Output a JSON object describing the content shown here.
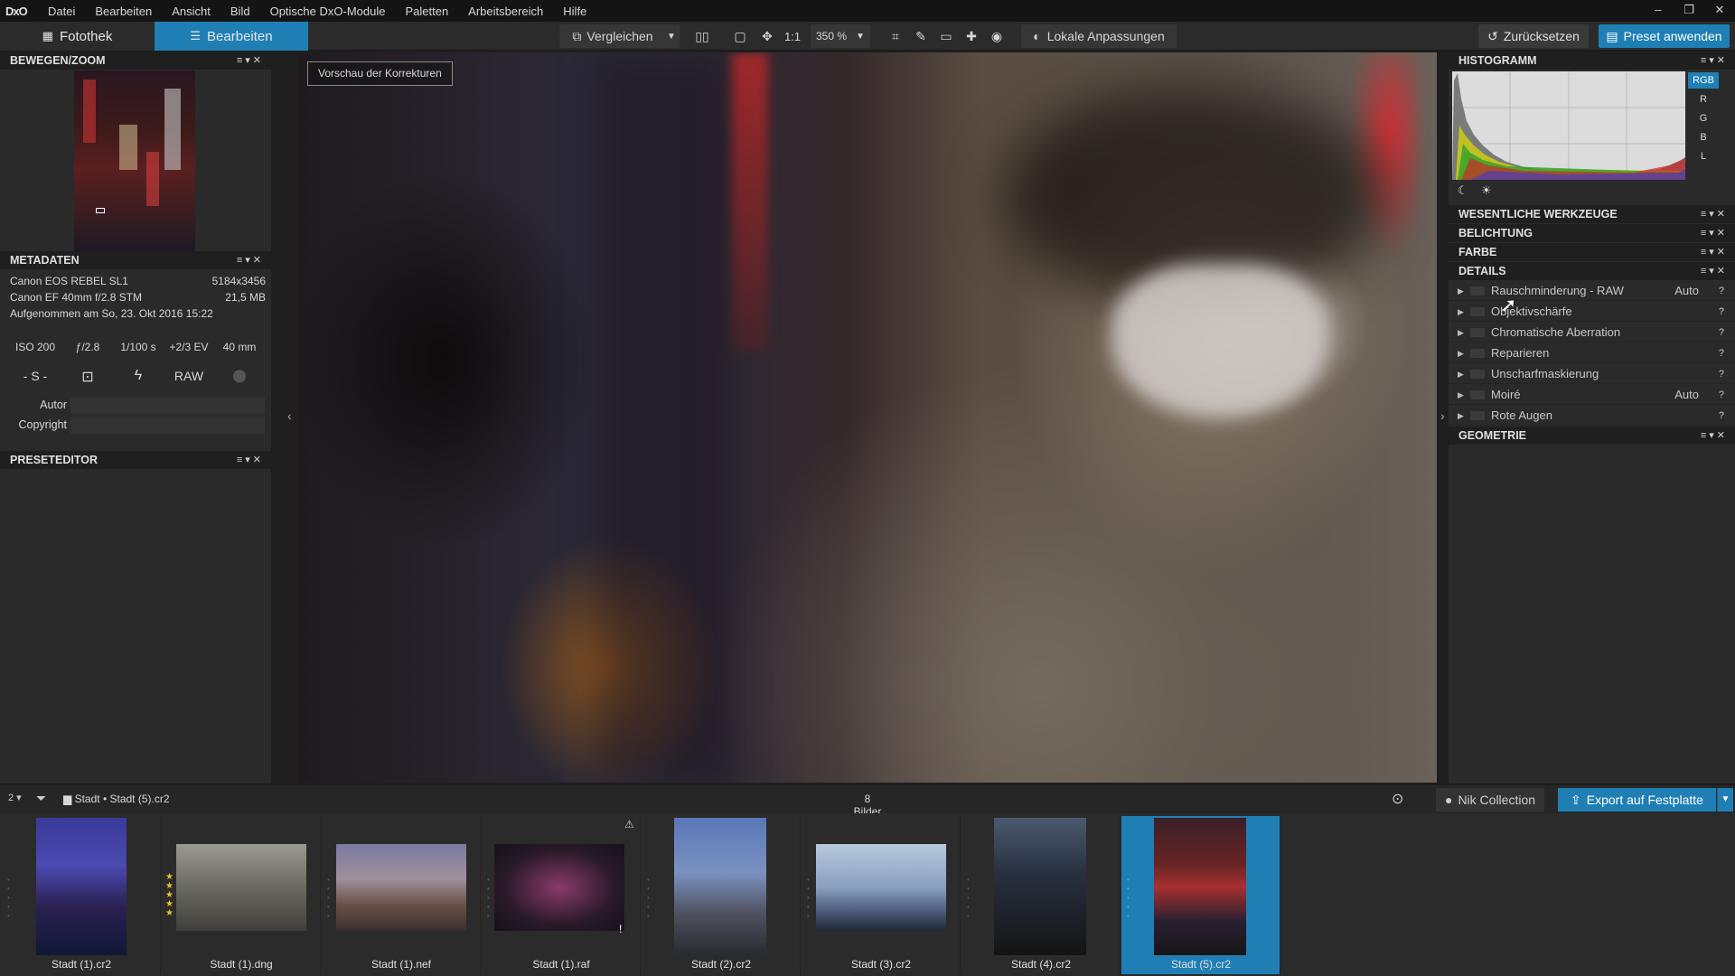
{
  "app": {
    "logo": "DxO"
  },
  "menu": [
    "Datei",
    "Bearbeiten",
    "Ansicht",
    "Bild",
    "Optische DxO-Module",
    "Paletten",
    "Arbeitsbereich",
    "Hilfe"
  ],
  "window_controls": [
    "–",
    "❐",
    "✕"
  ],
  "tabs": {
    "fotothek": "Fotothek",
    "bearbeiten": "Bearbeiten"
  },
  "toolbar": {
    "vergleichen": "Vergleichen",
    "one_to_one": "1:1",
    "zoom": "350 %",
    "lokale": "Lokale Anpassungen",
    "zuruck": "Zurücksetzen",
    "preset": "Preset anwenden"
  },
  "left": {
    "bewegen_title": "BEWEGEN/ZOOM",
    "metadaten_title": "METADATEN",
    "preseteditor_title": "PRESETEDITOR",
    "camera": "Canon EOS REBEL SL1",
    "resolution": "5184x3456",
    "lens": "Canon EF 40mm f/2.8 STM",
    "filesize": "21,5 MB",
    "taken": "Aufgenommen am So, 23. Okt 2016 15:22",
    "exif": [
      "ISO 200",
      "ƒ/2.8",
      "1/100 s",
      "+2/3 EV",
      "40 mm"
    ],
    "mode": "- S -",
    "raw": "RAW",
    "autor_label": "Autor",
    "copyright_label": "Copyright"
  },
  "viewer": {
    "preview_label": "Vorschau der Korrekturen"
  },
  "right": {
    "histogramm": "HISTOGRAMM",
    "channels": [
      "RGB",
      "R",
      "G",
      "B",
      "L"
    ],
    "sections": {
      "wesentliche": "WESENTLICHE WERKZEUGE",
      "belichtung": "BELICHTUNG",
      "farbe": "FARBE",
      "details": "DETAILS",
      "geometrie": "GEOMETRIE"
    },
    "details_items": [
      {
        "label": "Rauschminderung - RAW",
        "auto": "Auto"
      },
      {
        "label": "Objektivschärfe",
        "auto": ""
      },
      {
        "label": "Chromatische Aberration",
        "auto": ""
      },
      {
        "label": "Reparieren",
        "auto": ""
      },
      {
        "label": "Unscharfmaskierung",
        "auto": ""
      },
      {
        "label": "Moiré",
        "auto": "Auto"
      },
      {
        "label": "Rote Augen",
        "auto": ""
      }
    ],
    "help": "?"
  },
  "filmbar": {
    "sort": "2",
    "breadcrumb_folder": "Stadt",
    "breadcrumb_file": "Stadt (5).cr2",
    "count": "8 Bilder",
    "nik": "Nik Collection",
    "export": "Export auf Festplatte"
  },
  "film": [
    {
      "name": "Stadt (1).cr2",
      "stars": 0
    },
    {
      "name": "Stadt (1).dng",
      "stars": 5
    },
    {
      "name": "Stadt (1).nef",
      "stars": 0
    },
    {
      "name": "Stadt (1).raf",
      "stars": 0
    },
    {
      "name": "Stadt (2).cr2",
      "stars": 0
    },
    {
      "name": "Stadt (3).cr2",
      "stars": 0
    },
    {
      "name": "Stadt (4).cr2",
      "stars": 0
    },
    {
      "name": "Stadt (5).cr2",
      "stars": 0
    }
  ],
  "colors": {
    "accent": "#1f7fb4"
  }
}
